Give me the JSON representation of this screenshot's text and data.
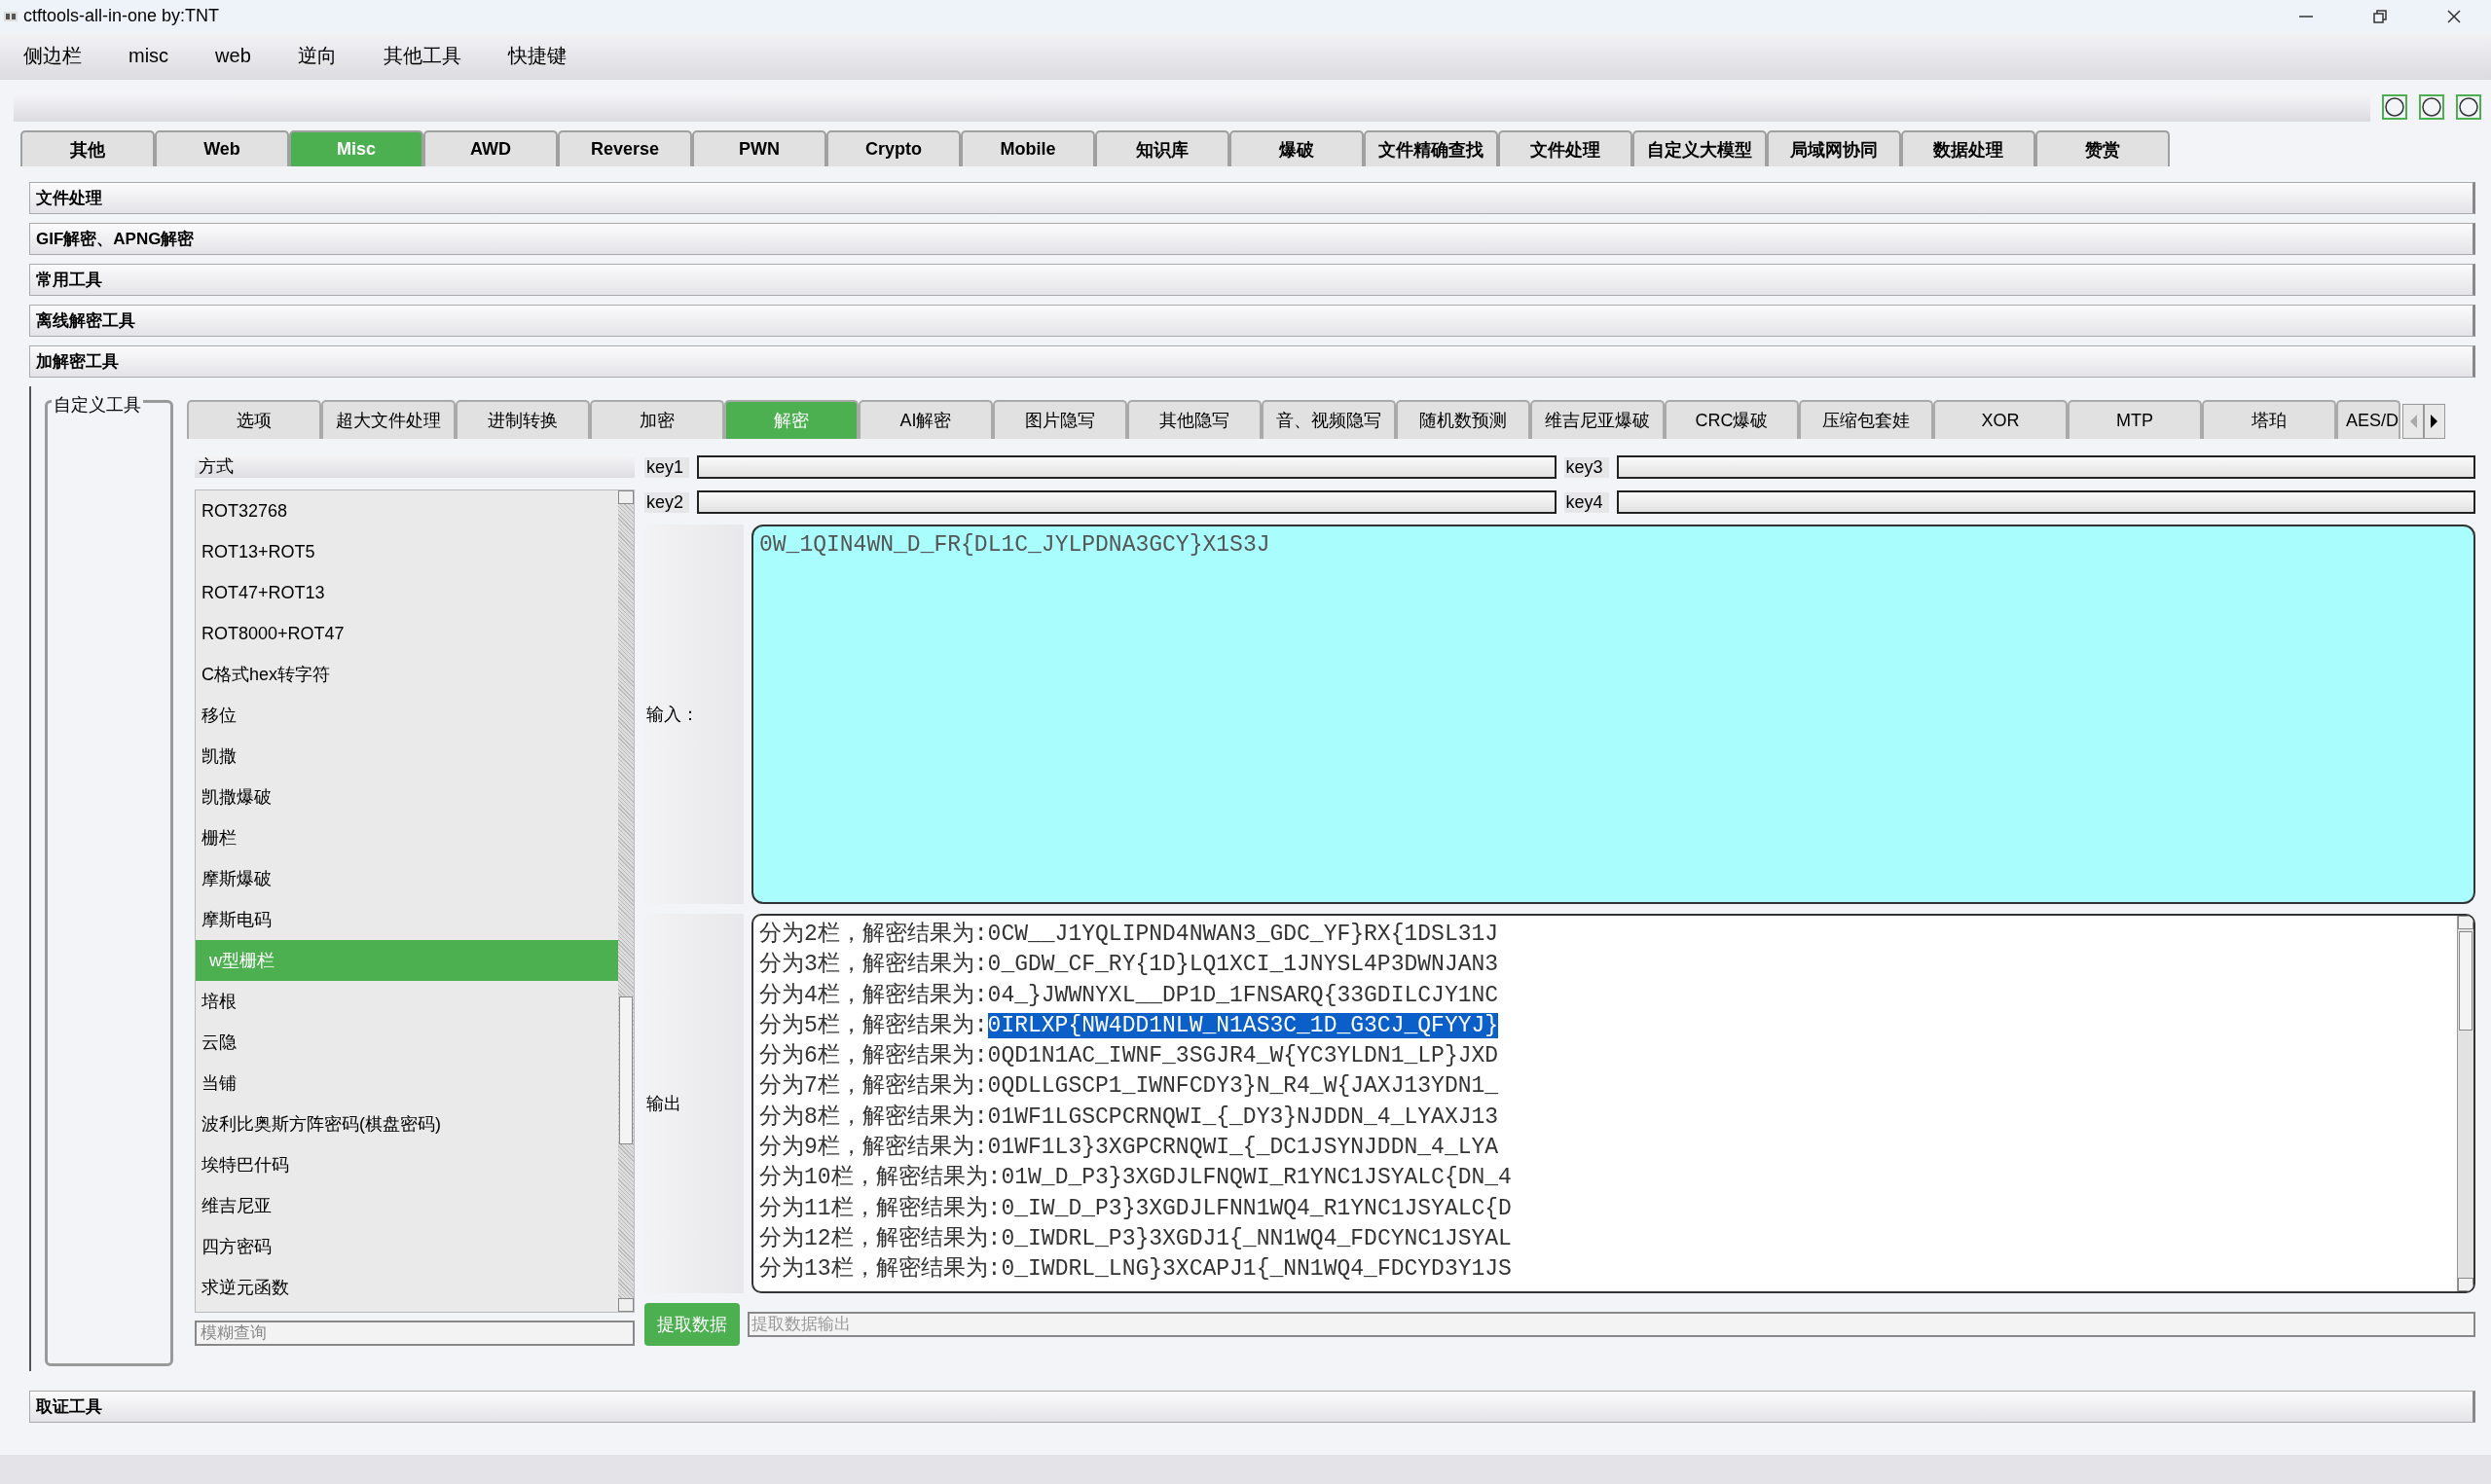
{
  "window": {
    "title": "ctftools-all-in-one   by:TNT"
  },
  "menu": [
    "侧边栏",
    "misc",
    "web",
    "逆向",
    "其他工具",
    "快捷键"
  ],
  "main_tabs": [
    {
      "label": "其他",
      "selected": false
    },
    {
      "label": "Web",
      "selected": false
    },
    {
      "label": "Misc",
      "selected": true
    },
    {
      "label": "AWD",
      "selected": false
    },
    {
      "label": "Reverse",
      "selected": false
    },
    {
      "label": "PWN",
      "selected": false
    },
    {
      "label": "Crypto",
      "selected": false
    },
    {
      "label": "Mobile",
      "selected": false
    },
    {
      "label": "知识库",
      "selected": false
    },
    {
      "label": "爆破",
      "selected": false
    },
    {
      "label": "文件精确查找",
      "selected": false
    },
    {
      "label": "文件处理",
      "selected": false
    },
    {
      "label": "自定义大模型",
      "selected": false
    },
    {
      "label": "局域网协同",
      "selected": false
    },
    {
      "label": "数据处理",
      "selected": false
    },
    {
      "label": "赞赏",
      "selected": false
    }
  ],
  "sections": [
    "文件处理",
    "GIF解密、APNG解密",
    "常用工具",
    "离线解密工具",
    "加解密工具"
  ],
  "custom_tools": {
    "title": "自定义工具"
  },
  "inner_tabs": [
    {
      "label": "选项",
      "selected": false
    },
    {
      "label": "超大文件处理",
      "selected": false
    },
    {
      "label": "进制转换",
      "selected": false
    },
    {
      "label": "加密",
      "selected": false
    },
    {
      "label": "解密",
      "selected": true
    },
    {
      "label": "AI解密",
      "selected": false
    },
    {
      "label": "图片隐写",
      "selected": false
    },
    {
      "label": "其他隐写",
      "selected": false
    },
    {
      "label": "音、视频隐写",
      "selected": false
    },
    {
      "label": "随机数预测",
      "selected": false
    },
    {
      "label": "维吉尼亚爆破",
      "selected": false
    },
    {
      "label": "CRC爆破",
      "selected": false
    },
    {
      "label": "压缩包套娃",
      "selected": false
    },
    {
      "label": "XOR",
      "selected": false
    },
    {
      "label": "MTP",
      "selected": false
    },
    {
      "label": "塔珀",
      "selected": false
    },
    {
      "label": "AES/D",
      "selected": false
    }
  ],
  "methods": {
    "header": "方式",
    "items": [
      {
        "label": "ROT32768",
        "selected": false
      },
      {
        "label": "ROT13+ROT5",
        "selected": false
      },
      {
        "label": "ROT47+ROT13",
        "selected": false
      },
      {
        "label": "ROT8000+ROT47",
        "selected": false
      },
      {
        "label": "C格式hex转字符",
        "selected": false
      },
      {
        "label": "移位",
        "selected": false
      },
      {
        "label": "凯撒",
        "selected": false
      },
      {
        "label": "凯撒爆破",
        "selected": false
      },
      {
        "label": "栅栏",
        "selected": false
      },
      {
        "label": "摩斯爆破",
        "selected": false
      },
      {
        "label": "摩斯电码",
        "selected": false
      },
      {
        "label": "w型栅栏",
        "selected": true
      },
      {
        "label": "培根",
        "selected": false
      },
      {
        "label": "云隐",
        "selected": false
      },
      {
        "label": "当铺",
        "selected": false
      },
      {
        "label": "波利比奥斯方阵密码(棋盘密码)",
        "selected": false
      },
      {
        "label": "埃特巴什码",
        "selected": false
      },
      {
        "label": "维吉尼亚",
        "selected": false
      },
      {
        "label": "四方密码",
        "selected": false
      },
      {
        "label": "求逆元函数",
        "selected": false
      }
    ],
    "search": {
      "placeholder": "模糊查询"
    }
  },
  "keys": [
    "key1",
    "key3",
    "key2",
    "key4"
  ],
  "input": {
    "label": "输入：",
    "value": "0W_1QIN4WN_D_FR{DL1C_JYLPDNA3GCY}X1S3J"
  },
  "output": {
    "label": "输出",
    "lines": [
      {
        "prefix": "分为2栏，解密结果为:",
        "result": "0CW__J1YQLIPND4NWAN3_GDC_YF}RX{1DSL31J",
        "selected": false
      },
      {
        "prefix": "分为3栏，解密结果为:",
        "result": "0_GDW_CF_RY{1D}LQ1XCI_1JNYSL4P3DWNJAN3",
        "selected": false
      },
      {
        "prefix": "分为4栏，解密结果为:",
        "result": "04_}JWWNYXL__DP1D_1FNSARQ{33GDILCJY1NC",
        "selected": false
      },
      {
        "prefix": "分为5栏，解密结果为:",
        "result": "0IRLXP{NW4DD1NLW_N1AS3C_1D_G3CJ_QFYYJ}",
        "selected": true
      },
      {
        "prefix": "分为6栏，解密结果为:",
        "result": "0QD1N1AC_IWNF_3SGJR4_W{YC3YLDN1_LP}JXD",
        "selected": false
      },
      {
        "prefix": "分为7栏，解密结果为:",
        "result": "0QDLLGSCP1_IWNFCDY3}N_R4_W{JAXJ13YDN1_",
        "selected": false
      },
      {
        "prefix": "分为8栏，解密结果为:",
        "result": "01WF1LGSCPCRNQWI_{_DY3}NJDDN_4_LYAXJ13",
        "selected": false
      },
      {
        "prefix": "分为9栏，解密结果为:",
        "result": "01WF1L3}3XGPCRNQWI_{_DC1JSYNJDDN_4_LYA",
        "selected": false
      },
      {
        "prefix": "分为10栏，解密结果为:",
        "result": "01W_D_P3}3XGDJLFNQWI_R1YNC1JSYALC{DN_4",
        "selected": false
      },
      {
        "prefix": "分为11栏，解密结果为:",
        "result": "0_IW_D_P3}3XGDJLFNN1WQ4_R1YNC1JSYALC{D",
        "selected": false
      },
      {
        "prefix": "分为12栏，解密结果为:",
        "result": "0_IWDRL_P3}3XGDJ1{_NN1WQ4_FDCYNC1JSYAL",
        "selected": false
      },
      {
        "prefix": "分为13栏，解密结果为:",
        "result": "0_IWDRL_LNG}3XCAPJ1{_NN1WQ4_FDCYD3Y1JS",
        "selected": false
      }
    ]
  },
  "extract": {
    "button": "提取数据",
    "placeholder": "提取数据输出"
  },
  "bottom_section": "取证工具"
}
